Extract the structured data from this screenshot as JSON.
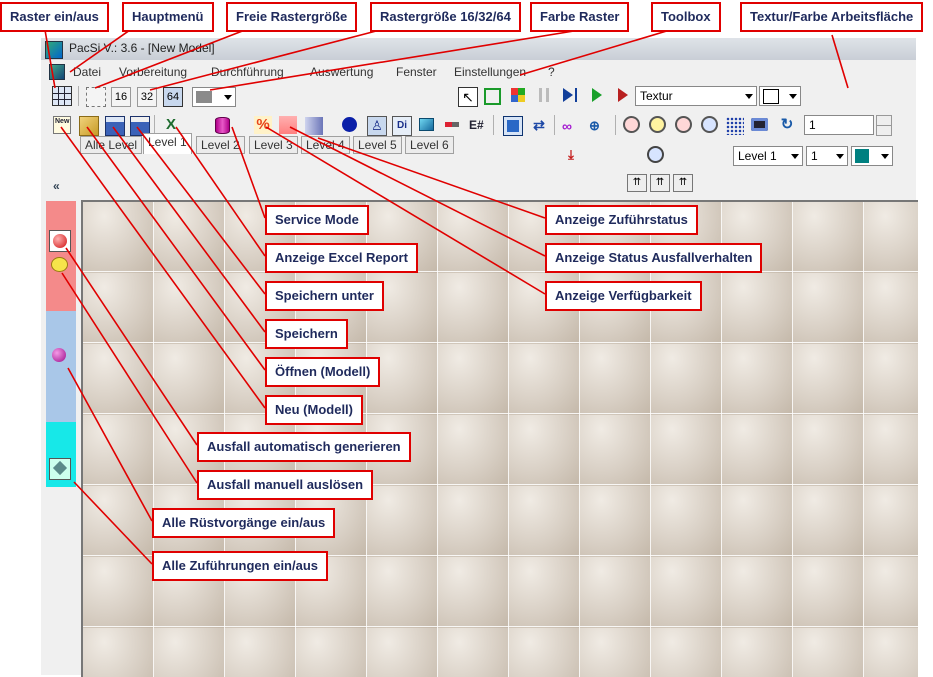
{
  "window": {
    "title": "PacSi V.: 3.6 - [New Model]"
  },
  "menu": {
    "items": [
      "Datei",
      "Vorbereitung",
      "Durchführung",
      "Auswertung",
      "Fenster",
      "Einstellungen",
      "?"
    ]
  },
  "toolbar1": {
    "grid_sizes": [
      "16",
      "32",
      "64"
    ],
    "texture_dropdown": "Textur"
  },
  "toolbar2": {
    "excel_label": "E#",
    "di_label": "Di",
    "new_label": "New",
    "counter_value": "1"
  },
  "toolbar3": {
    "level_dropdown": "Level 1",
    "number_dropdown": "1",
    "color_value": "#008080"
  },
  "tabs": [
    "Alle Level",
    "Level 1",
    "Level 2",
    "Level 3",
    "Level 4",
    "Level 5",
    "Level 6"
  ],
  "side_colors": {
    "red": "#f48a8a",
    "blue": "#a9c7e8",
    "cyan": "#17e8e8"
  },
  "callouts": {
    "raster": "Raster ein/aus",
    "hauptmenu": "Hauptmenü",
    "freie": "Freie Rastergröße",
    "rastergroesse": "Rastergröße 16/32/64",
    "farbe": "Farbe Raster",
    "toolbox": "Toolbox",
    "textur": "Textur/Farbe Arbeitsfläche",
    "service": "Service Mode",
    "excel": "Anzeige Excel Report",
    "speichern_unter": "Speichern unter",
    "speichern": "Speichern",
    "oeffnen": "Öffnen (Modell)",
    "neu": "Neu (Modell)",
    "ausfall_auto": "Ausfall automatisch generieren",
    "ausfall_manuell": "Ausfall manuell auslösen",
    "ruest": "Alle Rüstvorgänge ein/aus",
    "zufuehrungen": "Alle Zuführungen ein/aus",
    "zufuhrstatus": "Anzeige Zuführstatus",
    "ausfallverhalten": "Anzeige Status Ausfallverhalten",
    "verfuegbarkeit": "Anzeige Verfügbarkeit"
  }
}
